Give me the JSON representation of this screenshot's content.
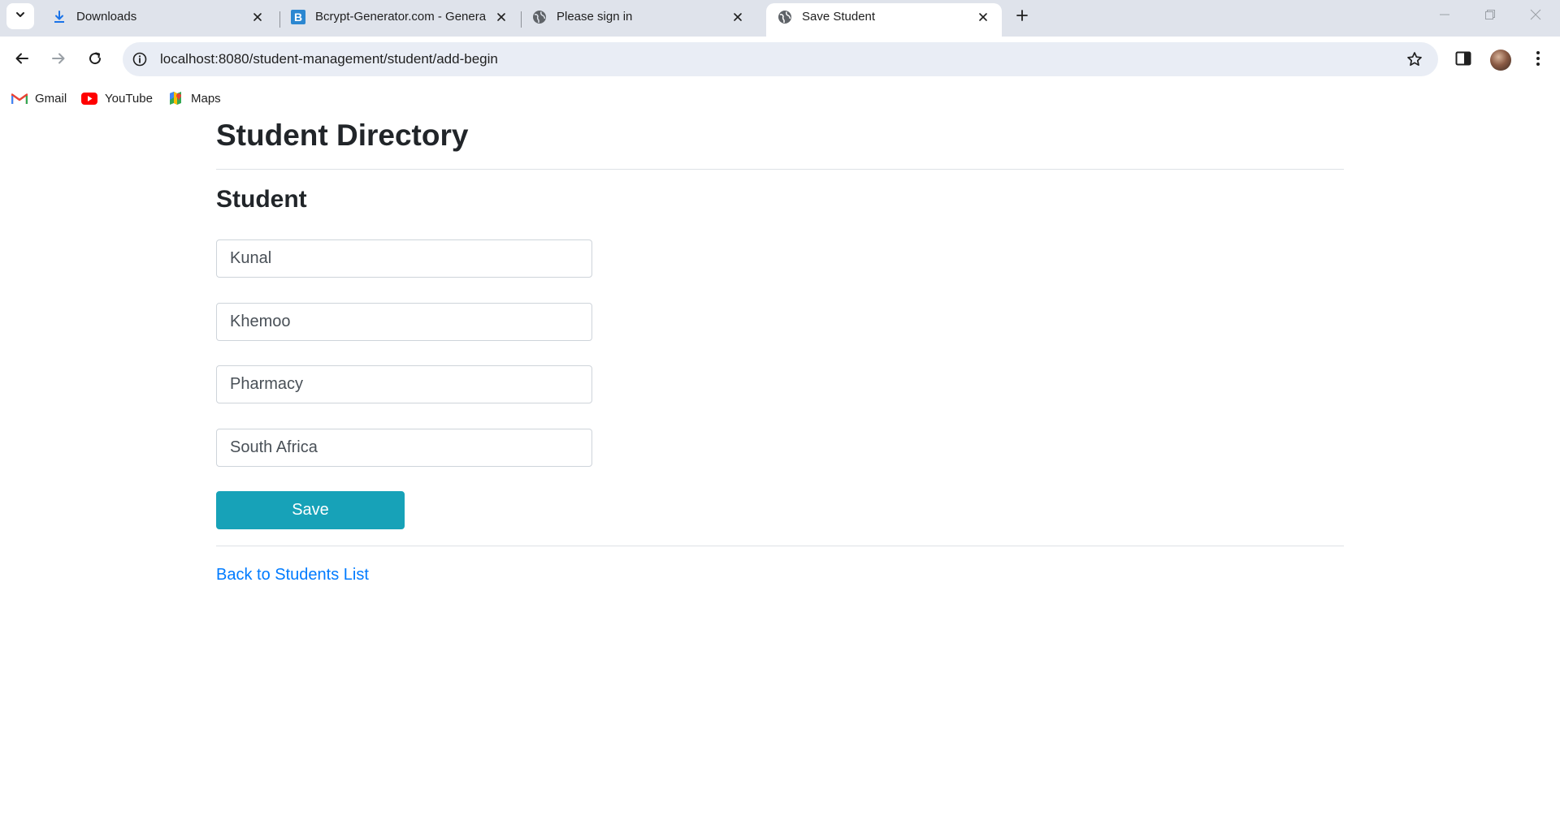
{
  "browser": {
    "tabs": [
      {
        "title": "Downloads",
        "favicon": "download-icon",
        "active": false
      },
      {
        "title": "Bcrypt-Generator.com - Genera",
        "favicon": "bcrypt-b-icon",
        "active": false
      },
      {
        "title": "Please sign in",
        "favicon": "globe-icon",
        "active": false
      },
      {
        "title": "Save Student",
        "favicon": "globe-icon",
        "active": true
      }
    ],
    "url": "localhost:8080/student-management/student/add-begin",
    "bookmarks": [
      {
        "label": "Gmail",
        "icon": "gmail-icon"
      },
      {
        "label": "YouTube",
        "icon": "youtube-icon"
      },
      {
        "label": "Maps",
        "icon": "maps-icon"
      }
    ]
  },
  "page": {
    "heading": "Student Directory",
    "subheading": "Student",
    "form": {
      "first_name": "Kunal",
      "last_name": "Khemoo",
      "course": "Pharmacy",
      "country": "South Africa",
      "save_label": "Save"
    },
    "back_link": "Back to Students List"
  },
  "colors": {
    "tabstrip_bg": "#dfe3eb",
    "omnibox_bg": "#e9edf5",
    "save_button": "#17a2b8",
    "link": "#007bff"
  }
}
